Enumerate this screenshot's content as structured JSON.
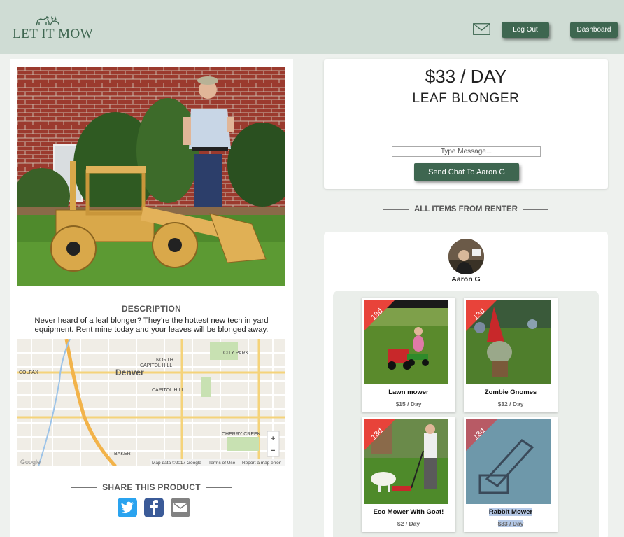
{
  "header": {
    "logo_text": "LET IT MOW",
    "logout_label": "Log Out",
    "dashboard_label": "Dashboard",
    "mail_icon": "envelope-icon"
  },
  "listing": {
    "price": "$33 / DAY",
    "name": "LEAF BLONGER",
    "message_placeholder": "Type Message...",
    "send_label": "Send Chat To Aaron G"
  },
  "description": {
    "title": "DESCRIPTION",
    "text": "Never heard of a leaf blonger? They're the hottest new tech in yard equipment. Rent mine today and your leaves will be blonged away."
  },
  "map": {
    "city": "Denver",
    "labels": [
      "COLFAX",
      "NORTH CAPITOL HILL",
      "CAPITOL HILL",
      "CITY PARK",
      "BAKER",
      "CHERRY CREEK"
    ],
    "zoom_in": "+",
    "zoom_out": "−",
    "google": "Google",
    "map_data": "Map data ©2017 Google",
    "terms": "Terms of Use",
    "report": "Report a map error"
  },
  "share": {
    "title": "SHARE THIS PRODUCT",
    "icons": [
      "twitter-icon",
      "facebook-icon",
      "email-icon"
    ]
  },
  "renter": {
    "section_title": "ALL ITEMS FROM RENTER",
    "name": "Aaron G"
  },
  "items": [
    {
      "title": "Lawn mower",
      "price": "$15 / Day",
      "badge": "18d"
    },
    {
      "title": "Zombie Gnomes",
      "price": "$32 / Day",
      "badge": "13d"
    },
    {
      "title": "Eco Mower With Goat!",
      "price": "$2 / Day",
      "badge": "13d"
    },
    {
      "title": "Rabbit Mower",
      "price": "$33 / Day",
      "badge": "13d"
    }
  ],
  "colors": {
    "brand": "#3e6650",
    "header_bg": "#cfdcd4",
    "badge": "#e8433a"
  }
}
